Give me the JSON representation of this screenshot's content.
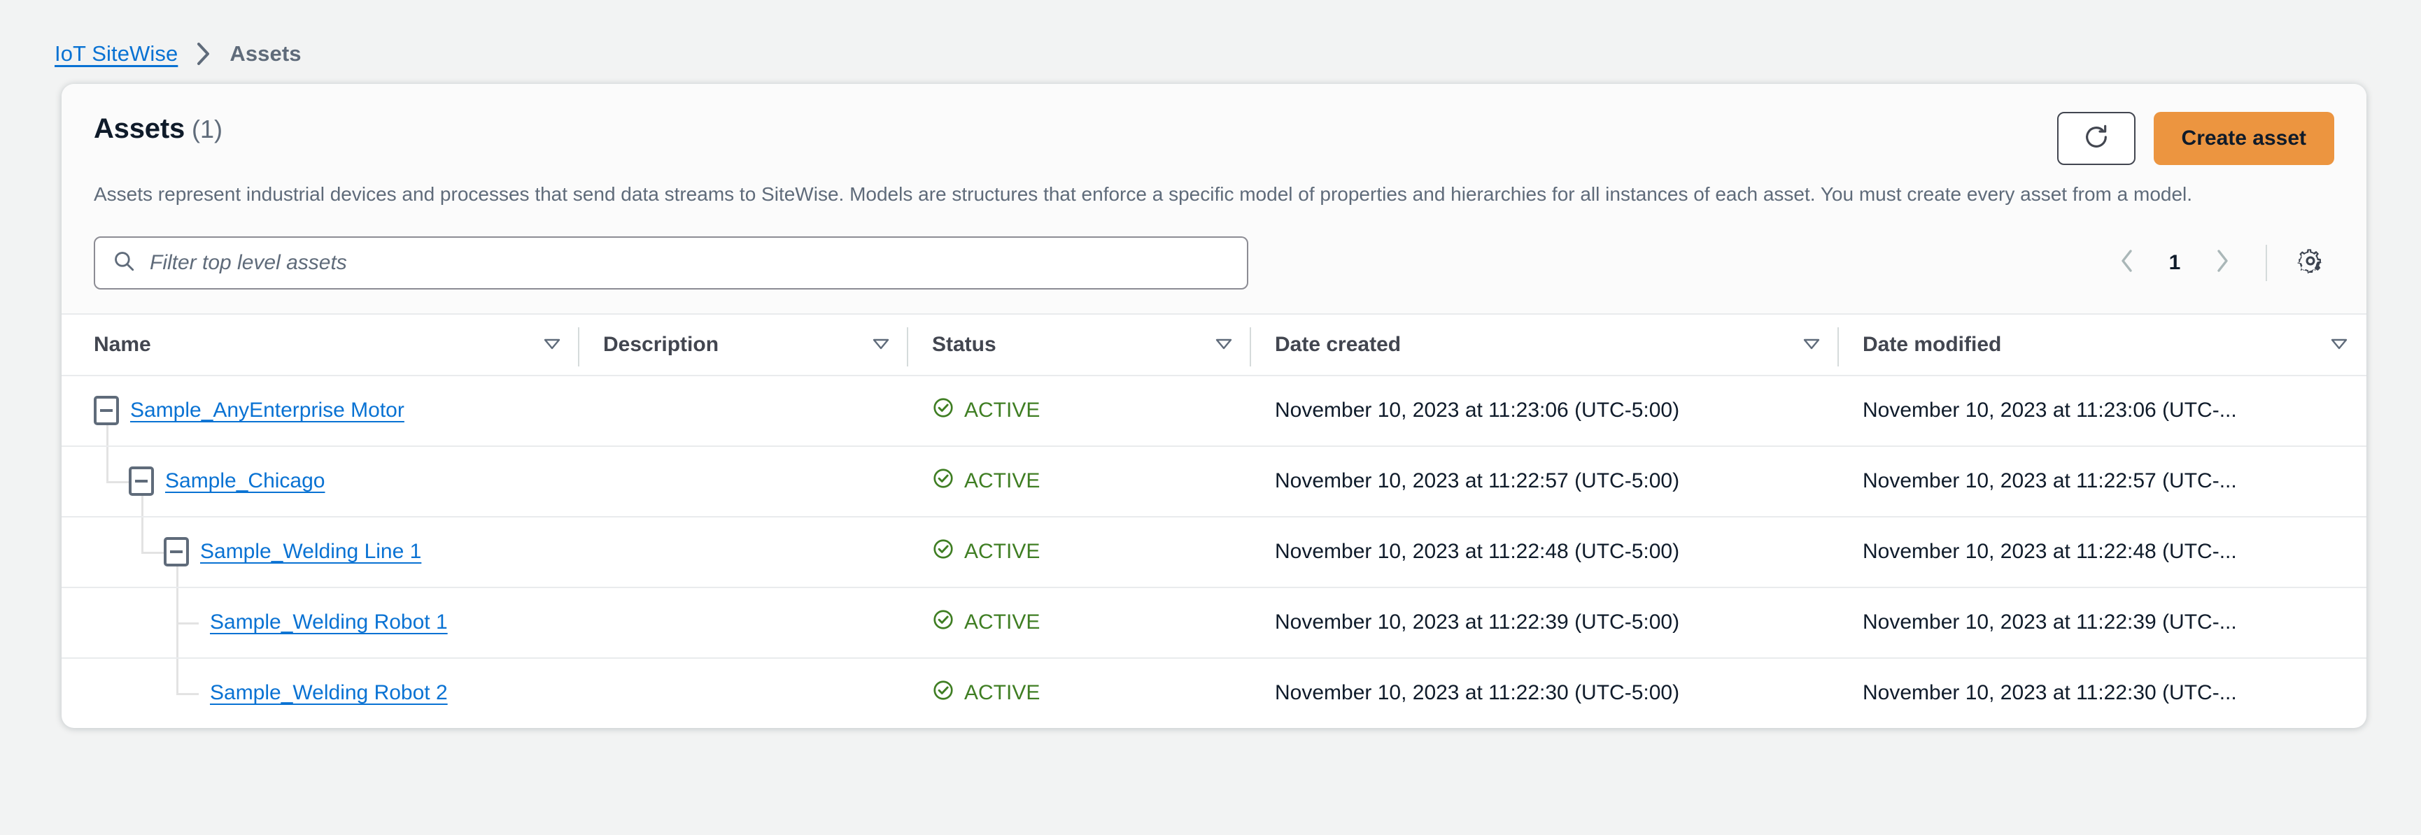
{
  "breadcrumb": {
    "root_label": "IoT SiteWise",
    "separator": "chevron-right-icon",
    "current_label": "Assets"
  },
  "panel": {
    "title": "Assets",
    "count": "(1)",
    "description": "Assets represent industrial devices and processes that send data streams to SiteWise. Models are structures that enforce a specific model of properties and hierarchies for all instances of each asset. You must create every asset from a model.",
    "refresh_icon": "refresh-icon",
    "create_button_label": "Create asset",
    "create_button_color": "#ec9540"
  },
  "filter": {
    "icon": "search-icon",
    "placeholder": "Filter top level assets",
    "value": ""
  },
  "pagination": {
    "prev_icon": "chevron-left-icon",
    "page_number": "1",
    "next_icon": "chevron-right-icon",
    "settings_icon": "gear-icon"
  },
  "table": {
    "columns": [
      {
        "label": "Name",
        "sort_icon": "sort-triangle-icon"
      },
      {
        "label": "Description",
        "sort_icon": "sort-triangle-icon"
      },
      {
        "label": "Status",
        "sort_icon": "sort-triangle-icon"
      },
      {
        "label": "Date created",
        "sort_icon": "sort-triangle-icon"
      },
      {
        "label": "Date modified",
        "sort_icon": "sort-triangle-icon"
      }
    ],
    "status_color": "#3f7e23",
    "link_color": "#0972d3",
    "rows": [
      {
        "name": "Sample_AnyEnterprise Motor",
        "depth": 0,
        "expandable": true,
        "expanded": true,
        "description": "",
        "status": "ACTIVE",
        "status_icon": "check-circle-icon",
        "date_created": "November 10, 2023 at 11:23:06 (UTC-5:00)",
        "date_modified": "November 10, 2023 at 11:23:06 (UTC-..."
      },
      {
        "name": "Sample_Chicago",
        "depth": 1,
        "expandable": true,
        "expanded": true,
        "description": "",
        "status": "ACTIVE",
        "status_icon": "check-circle-icon",
        "date_created": "November 10, 2023 at 11:22:57 (UTC-5:00)",
        "date_modified": "November 10, 2023 at 11:22:57 (UTC-..."
      },
      {
        "name": "Sample_Welding Line 1",
        "depth": 2,
        "expandable": true,
        "expanded": true,
        "description": "",
        "status": "ACTIVE",
        "status_icon": "check-circle-icon",
        "date_created": "November 10, 2023 at 11:22:48 (UTC-5:00)",
        "date_modified": "November 10, 2023 at 11:22:48 (UTC-..."
      },
      {
        "name": "Sample_Welding Robot 1",
        "depth": 3,
        "expandable": false,
        "expanded": false,
        "description": "",
        "status": "ACTIVE",
        "status_icon": "check-circle-icon",
        "date_created": "November 10, 2023 at 11:22:39 (UTC-5:00)",
        "date_modified": "November 10, 2023 at 11:22:39 (UTC-..."
      },
      {
        "name": "Sample_Welding Robot 2",
        "depth": 3,
        "expandable": false,
        "expanded": false,
        "description": "",
        "status": "ACTIVE",
        "status_icon": "check-circle-icon",
        "date_created": "November 10, 2023 at 11:22:30 (UTC-5:00)",
        "date_modified": "November 10, 2023 at 11:22:30 (UTC-..."
      }
    ]
  }
}
